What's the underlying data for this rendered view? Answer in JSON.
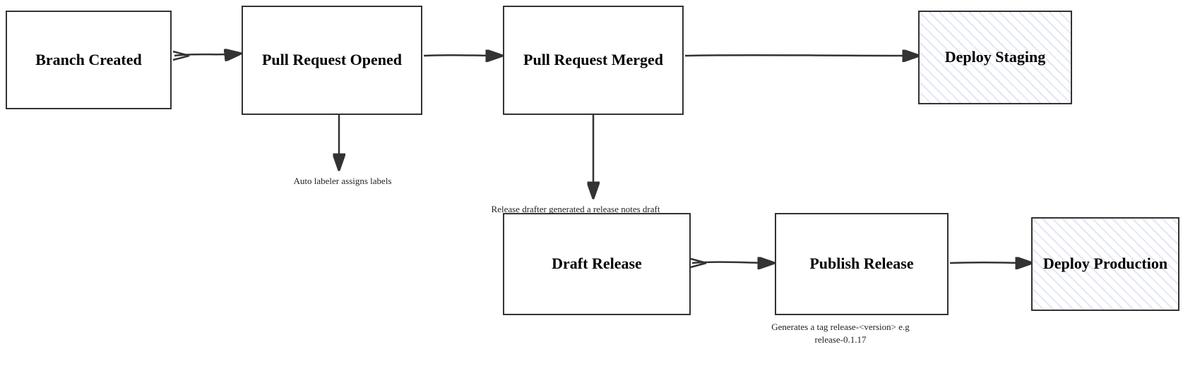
{
  "boxes": {
    "branch_created": {
      "label": "Branch\nCreated"
    },
    "pull_request_opened": {
      "label": "Pull Request\nOpened"
    },
    "pull_request_merged": {
      "label": "Pull Request\nMerged"
    },
    "deploy_staging": {
      "label": "Deploy\nStaging"
    },
    "draft_release": {
      "label": "Draft\nRelease"
    },
    "publish_release": {
      "label": "Publish\nRelease"
    },
    "deploy_production": {
      "label": "Deploy\nProduction"
    }
  },
  "labels": {
    "auto_labeler": "Auto labeler assigns labels",
    "release_drafter": "Release drafter generated\na release notes draft",
    "generates_tag": "Generates a tag\nrelease-<version>\ne.g release-0.1.17"
  }
}
